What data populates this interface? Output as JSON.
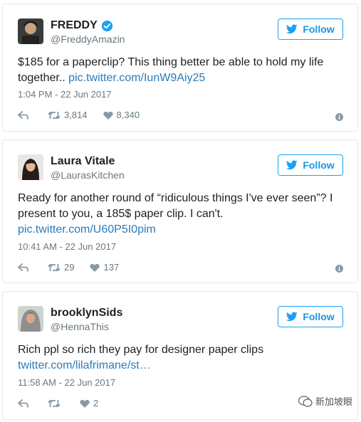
{
  "tweets": [
    {
      "name": "FREDDY",
      "handle": "@FreddyAmazin",
      "verified": true,
      "follow_label": "Follow",
      "text_lines": [
        "$185 for a paperclip? This thing better be able to hold my life",
        "together.. "
      ],
      "link": "pic.twitter.com/IunW9Aiy25",
      "timestamp": "1:04 PM - 22 Jun 2017",
      "retweets": "3,814",
      "likes": "8,340"
    },
    {
      "name": "Laura Vitale",
      "handle": "@LaurasKitchen",
      "verified": false,
      "follow_label": "Follow",
      "text_lines": [
        "Ready for another round of “ridiculous things I've ever seen”? I",
        "present to you, a 185$ paper clip. I can't."
      ],
      "link": "pic.twitter.com/U60P5I0pim",
      "timestamp": "10:41 AM - 22 Jun 2017",
      "retweets": "29",
      "likes": "137"
    },
    {
      "name": "brooklynSids",
      "handle": "@HennaThis",
      "verified": false,
      "follow_label": "Follow",
      "text_lines": [
        "Rich ppl so rich they pay for designer paper clips"
      ],
      "link": "twitter.com/lilafrimane/st…",
      "timestamp": "11:58 AM - 22 Jun 2017",
      "retweets": "",
      "likes": "2"
    }
  ],
  "watermark": "新加坡眼",
  "colors": {
    "accent": "#1da1f2",
    "link": "#2b7bb9",
    "muted": "#697882"
  },
  "icons": [
    "verified-badge-icon",
    "twitter-bird-icon",
    "reply-icon",
    "retweet-icon",
    "heart-icon",
    "info-icon"
  ]
}
